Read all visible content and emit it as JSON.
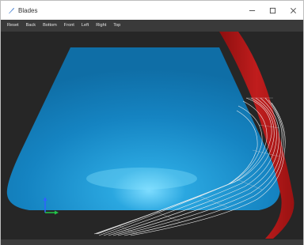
{
  "window": {
    "title": "Blades",
    "controls": {
      "minimize_icon": "minimize-icon",
      "maximize_icon": "maximize-icon",
      "close_icon": "close-icon"
    }
  },
  "menu": {
    "items": [
      {
        "label": "Reset"
      },
      {
        "label": "Back"
      },
      {
        "label": "Bottom"
      },
      {
        "label": "Front"
      },
      {
        "label": "Left"
      },
      {
        "label": "Right"
      },
      {
        "label": "Top"
      }
    ]
  },
  "viewport": {
    "colors": {
      "background": "#262626",
      "hub_surface": "#1f8fd0",
      "hub_glow": "#6fd8ff",
      "blade_red": "#b01818",
      "blade_mesh": "#f0f0f0"
    },
    "axes_icons": [
      "y-axis-arrow-icon",
      "x-axis-arrow-icon"
    ]
  }
}
